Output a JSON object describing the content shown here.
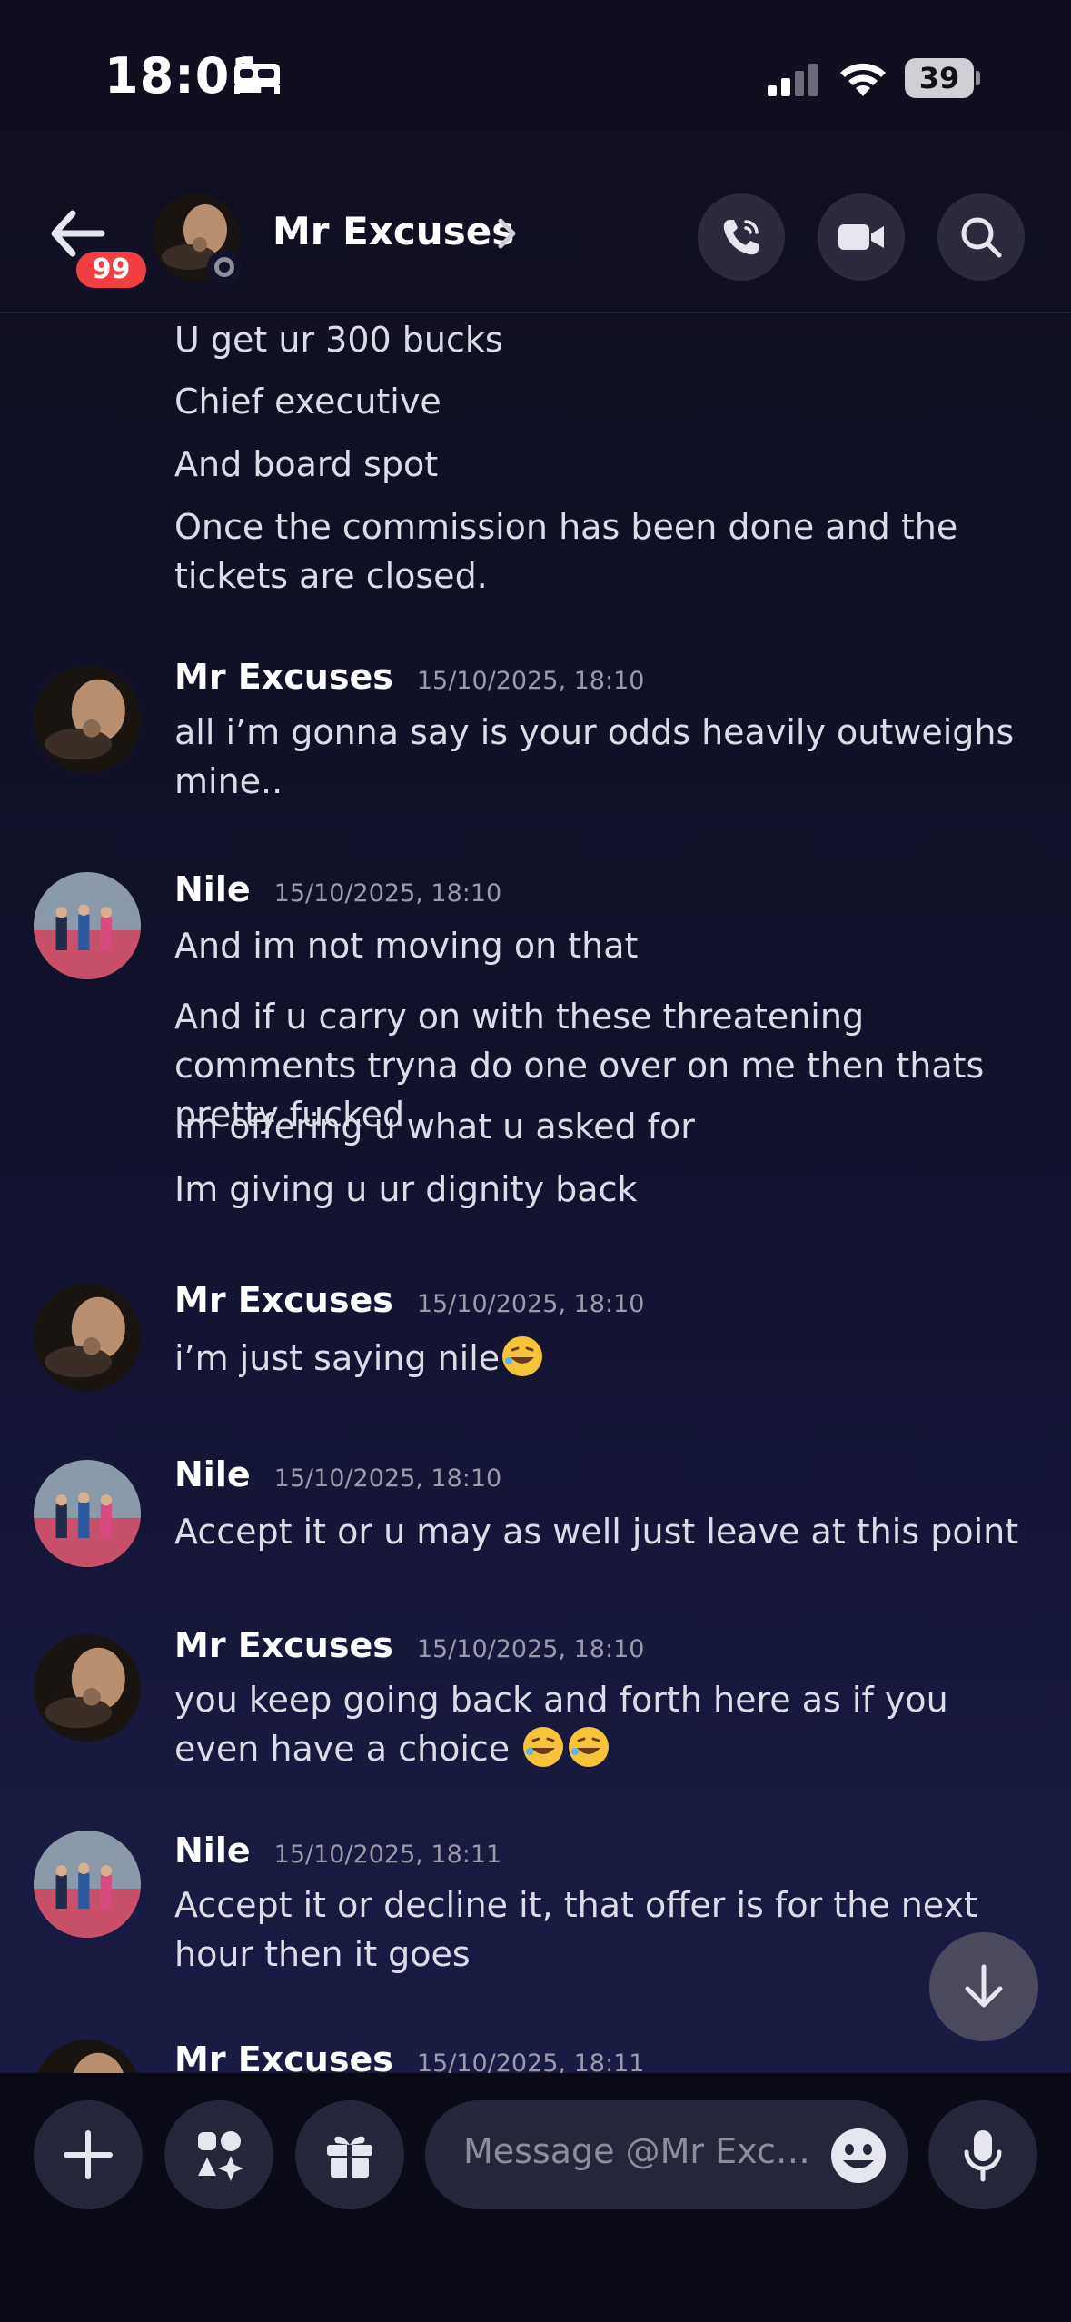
{
  "status_bar": {
    "time": "18:01",
    "battery": "39"
  },
  "header": {
    "title": "Mr Excuses",
    "unread_badge": "99"
  },
  "messages": {
    "continued_lines": [
      "U get ur 300 bucks",
      "Chief executive",
      "And board spot",
      "Once the commission has been done and the tickets are closed."
    ],
    "groups": [
      {
        "author": "Mr Excuses",
        "timestamp": "15/10/2025, 18:10",
        "lines": [
          "all i’m gonna say is your odds heavily outweighs mine.."
        ]
      },
      {
        "author": "Nile",
        "timestamp": "15/10/2025, 18:10",
        "lines": [
          "And im not moving on that",
          "And if u carry on with these threatening comments tryna do one over on me then thats pretty fucked",
          "Im offering u what u asked for",
          "Im giving u ur dignity back"
        ]
      },
      {
        "author": "Mr Excuses",
        "timestamp": "15/10/2025, 18:10",
        "lines": [
          "i’m just saying nile"
        ]
      },
      {
        "author": "Nile",
        "timestamp": "15/10/2025, 18:10",
        "lines": [
          "Accept it or u may as well just leave at this point"
        ]
      },
      {
        "author": "Mr Excuses",
        "timestamp": "15/10/2025, 18:10",
        "lines": [
          "you keep going back and forth here as if you even have a choice "
        ]
      },
      {
        "author": "Nile",
        "timestamp": "15/10/2025, 18:11",
        "lines": [
          "Accept it or decline it, that offer is for the next hour then it goes"
        ]
      },
      {
        "author": "Mr Excuses",
        "timestamp": "15/10/2025, 18:11",
        "lines": []
      }
    ]
  },
  "composer": {
    "placeholder": "Message @Mr Excu..."
  },
  "colors": {
    "background": "#11112a",
    "badge": "#f23f43",
    "button": "#26263a",
    "text": "#dcdce6"
  }
}
